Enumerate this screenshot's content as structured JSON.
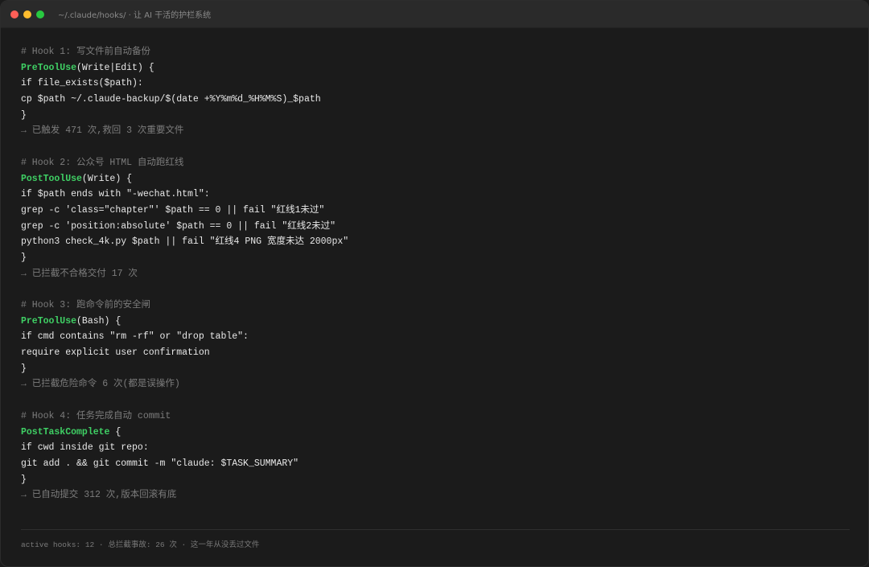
{
  "window": {
    "title": "~/.claude/hooks/ · 让 AI 干活的护栏系统"
  },
  "hooks": [
    {
      "comment": "# Hook 1: 写文件前自动备份",
      "keyword": "PreToolUse",
      "header_rest": "(Write|Edit) {",
      "body": [
        "if file_exists($path):",
        "cp $path ~/.claude-backup/$(date +%Y%m%d_%H%M%S)_$path"
      ],
      "close": "}",
      "result": "→ 已触发 471 次,救回 3 次重要文件"
    },
    {
      "comment": "# Hook 2: 公众号 HTML 自动跑红线",
      "keyword": "PostToolUse",
      "header_rest": "(Write) {",
      "body": [
        "if $path ends with \"-wechat.html\":",
        "grep -c 'class=\"chapter\"' $path == 0 || fail \"红线1未过\"",
        "grep -c 'position:absolute' $path == 0 || fail \"红线2未过\"",
        "python3 check_4k.py $path || fail \"红线4 PNG 宽度未达 2000px\""
      ],
      "close": "}",
      "result": "→ 已拦截不合格交付 17 次"
    },
    {
      "comment": "# Hook 3: 跑命令前的安全闸",
      "keyword": "PreToolUse",
      "header_rest": "(Bash) {",
      "body": [
        "if cmd contains \"rm -rf\" or \"drop table\":",
        "require explicit user confirmation"
      ],
      "close": "}",
      "result": "→ 已拦截危险命令 6 次(都是误操作)"
    },
    {
      "comment": "# Hook 4: 任务完成自动 commit",
      "keyword": "PostTaskComplete",
      "header_rest": " {",
      "body": [
        "if cwd inside git repo:",
        "git add . && git commit -m \"claude: $TASK_SUMMARY\""
      ],
      "close": "}",
      "result": "→ 已自动提交 312 次,版本回滚有底"
    }
  ],
  "footer": {
    "text": "active hooks: 12 · 总拦截事故: 26 次 · 这一年从没丢过文件"
  }
}
